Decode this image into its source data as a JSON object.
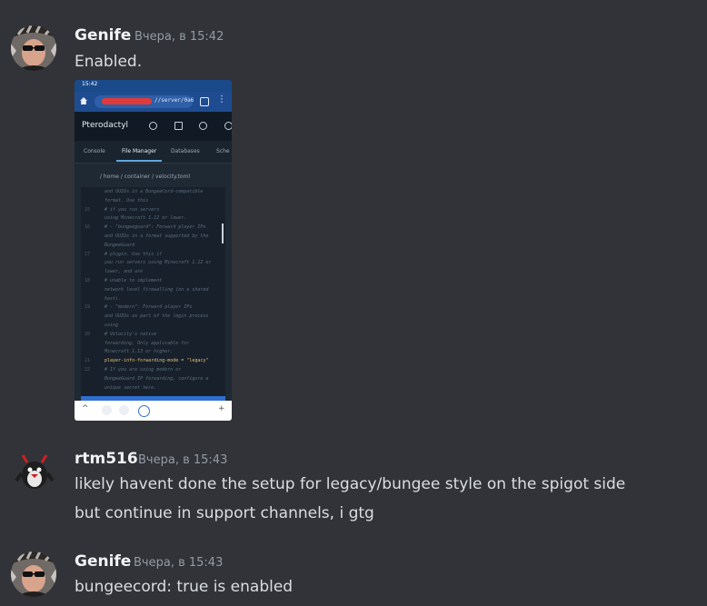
{
  "messages": [
    {
      "username": "Genife",
      "timestamp": "Вчера, в 15:42",
      "lines": [
        "Enabled."
      ],
      "attachment": {
        "status_time": "15:42",
        "url_path": "//server/0a6",
        "app_title": "Pterodactyl",
        "tabs": [
          "Console",
          "File Manager",
          "Databases",
          "Sche"
        ],
        "breadcrumb": "/ home / container / velocity.toml",
        "code_lines": [
          {
            "num": "",
            "text": "and UUIDs in a BungeeCord-compatible"
          },
          {
            "num": "",
            "text": "format. Use this"
          },
          {
            "num": "15",
            "text": "#              if you run servers"
          },
          {
            "num": "",
            "text": "using Minecraft 1.12 or lower."
          },
          {
            "num": "16",
            "text": "# - \"bungeeguard\": Forward player IPs"
          },
          {
            "num": "",
            "text": "and UUIDs in a format supported by the"
          },
          {
            "num": "",
            "text": "BungeeGuard"
          },
          {
            "num": "17",
            "text": "#              plugin. Use this if"
          },
          {
            "num": "",
            "text": "you run servers using Minecraft 1.12 or"
          },
          {
            "num": "",
            "text": "lower, and are"
          },
          {
            "num": "18",
            "text": "#              unable to implement"
          },
          {
            "num": "",
            "text": "network level firewalling (on a shared"
          },
          {
            "num": "",
            "text": "host)."
          },
          {
            "num": "19",
            "text": "# - \"modern\":     Forward player IPs"
          },
          {
            "num": "",
            "text": "and UUIDs as part of the login process"
          },
          {
            "num": "",
            "text": "using"
          },
          {
            "num": "20",
            "text": "#              Velocity's native"
          },
          {
            "num": "",
            "text": "forwarding. Only applicable for"
          },
          {
            "num": "",
            "text": "Minecraft 1.13 or higher."
          },
          {
            "num": "21",
            "text": "player-info-forwarding-mode = \"legacy\"",
            "code": true
          },
          {
            "num": "22",
            "text": "# If you are using modern or"
          },
          {
            "num": "",
            "text": "BungeeGuard IP forwarding, configure a"
          },
          {
            "num": "",
            "text": "unique secret here."
          }
        ],
        "nav_plus": "+",
        "nav_back": "^"
      }
    },
    {
      "username": "rtm516",
      "timestamp": "Вчера, в 15:43",
      "lines": [
        "likely havent done the setup for legacy/bungee style on the spigot side",
        "but continue in support channels, i gtg"
      ]
    },
    {
      "username": "Genife",
      "timestamp": "Вчера, в 15:43",
      "lines": [
        "bungeecord: true is enabled"
      ]
    }
  ],
  "colors": {
    "background": "#313338",
    "username": "#f2f3f5",
    "timestamp": "#949ba4",
    "text": "#dbdee1"
  }
}
